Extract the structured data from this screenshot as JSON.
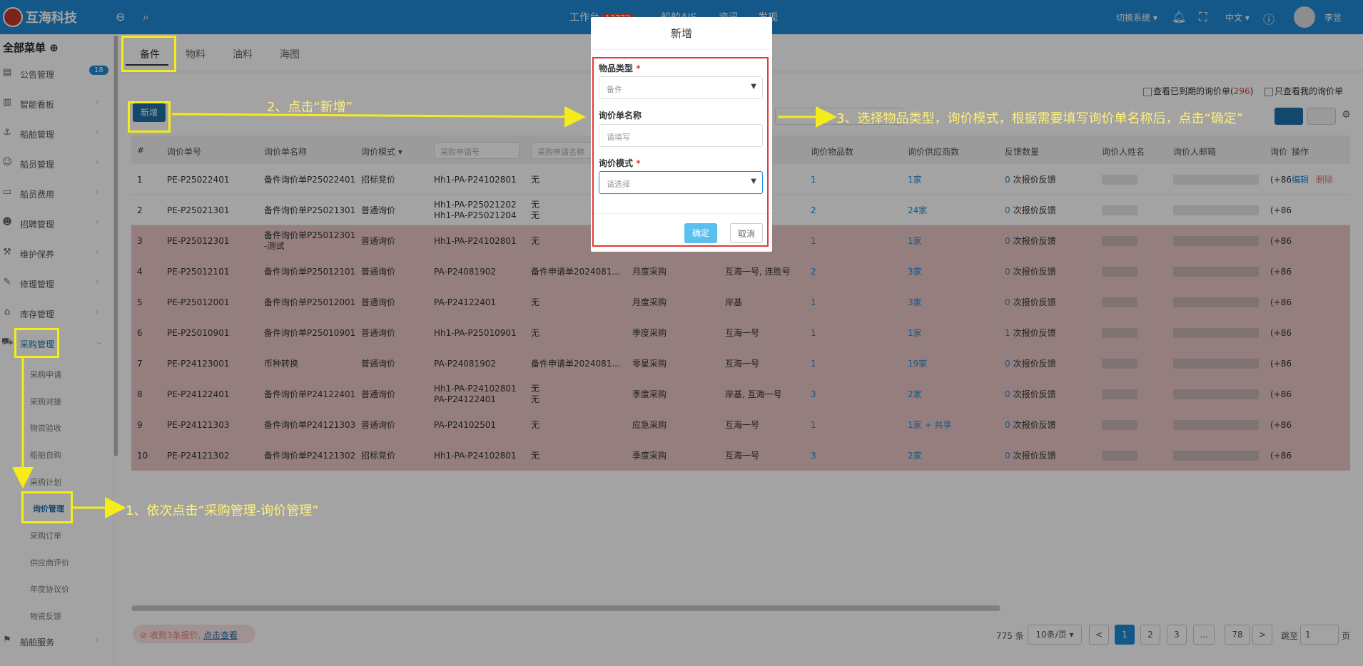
{
  "header": {
    "app_name": "互海科技",
    "nav_workbench": "工作台",
    "nav_badge": "13772",
    "nav_ais": "船舶AIS",
    "nav_3": "资讯",
    "nav_4": "发现",
    "switch_system": "切换系统",
    "language": "中文",
    "user_name": "李昱"
  },
  "sidebar": {
    "title": "全部菜单",
    "items": [
      {
        "label": "公告管理",
        "icon": "book-icon"
      },
      {
        "label": "智能看板",
        "icon": "chart-icon"
      },
      {
        "label": "船舶管理",
        "icon": "anchor-icon"
      },
      {
        "label": "船员管理",
        "icon": "user-icon"
      },
      {
        "label": "船员费用",
        "icon": "wallet-icon"
      },
      {
        "label": "招聘管理",
        "icon": "user-plus-icon"
      },
      {
        "label": "维护保养",
        "icon": "wrench-icon"
      },
      {
        "label": "修理管理",
        "icon": "tool-icon"
      },
      {
        "label": "库存管理",
        "icon": "warehouse-icon"
      },
      {
        "label": "采购管理",
        "icon": "cart-icon"
      },
      {
        "label": "船舶服务",
        "icon": "hammer-icon"
      }
    ],
    "announcement_count": "18",
    "sub_items": [
      "采购申请",
      "采购对接",
      "物资验收",
      "船舶自购",
      "采购计划",
      "询价管理",
      "采购订单",
      "供应商评价",
      "年度协议价",
      "物资反馈"
    ]
  },
  "tabs": [
    "备件",
    "物料",
    "油料",
    "海图"
  ],
  "toolbar": {
    "add_label": "新增",
    "expired_label": "查看已到期的询价单(",
    "expired_count": "296",
    "expired_close": ")",
    "mine_label": "只查看我的询价单"
  },
  "table": {
    "headers": [
      "#",
      "询价单号",
      "询价单名称",
      "询价模式",
      "采购申请号",
      "采购申请名称",
      "询价物品数",
      "询价供应商数",
      "反馈数量",
      "询价人姓名",
      "询价人邮箱",
      "询价",
      "操作"
    ],
    "filter_placeholder_1": "采购申请号",
    "filter_placeholder_2": "采购申请名称",
    "rows": [
      {
        "n": "1",
        "no": "PE-P25022401",
        "name": "备件询价单P25022401",
        "mode": "招标竞价",
        "req": "Hh1-PA-P24102801",
        "req_name": "无",
        "type": "",
        "ship": "",
        "items": "1",
        "suppliers": "1家",
        "fb_n": "0",
        "fb_t": "次报价反馈",
        "tail": "(+86",
        "edit": "编辑",
        "del": "删除"
      },
      {
        "n": "2",
        "no": "PE-P25021301",
        "name": "备件询价单P25021301",
        "mode": "普通询价",
        "req": "Hh1-PA-P25021202",
        "req2": "Hh1-PA-P25021204",
        "req_name": "无",
        "req_name2": "无",
        "type": "",
        "ship": "",
        "items": "2",
        "suppliers": "24家",
        "fb_n": "0",
        "fb_t": "次报价反馈",
        "tail": "(+86"
      },
      {
        "n": "3",
        "no": "PE-P25012301",
        "name": "备件询价单P25012301",
        "name2": "-测试",
        "mode": "普通询价",
        "req": "Hh1-PA-P24102801",
        "req_name": "无",
        "type": "",
        "ship": "",
        "items": "1",
        "suppliers": "1家",
        "fb_n": "0",
        "fb_t": "次报价反馈",
        "tail": "(+86"
      },
      {
        "n": "4",
        "no": "PE-P25012101",
        "name": "备件询价单P25012101",
        "mode": "普通询价",
        "req": "PA-P24081902",
        "req_name": "备件申请单2024081...",
        "type": "月度采购",
        "ship": "互海一号, 连胜号",
        "items": "2",
        "suppliers": "3家",
        "fb_n": "0",
        "fb_t": "次报价反馈",
        "tail": "(+86"
      },
      {
        "n": "5",
        "no": "PE-P25012001",
        "name": "备件询价单P25012001",
        "mode": "普通询价",
        "req": "PA-P24122401",
        "req_name": "无",
        "type": "月度采购",
        "ship": "岸基",
        "items": "1",
        "suppliers": "3家",
        "fb_n": "0",
        "fb_t": "次报价反馈",
        "tail": "(+86"
      },
      {
        "n": "6",
        "no": "PE-P25010901",
        "name": "备件询价单P25010901",
        "mode": "普通询价",
        "req": "Hh1-PA-P25010901",
        "req_name": "无",
        "type": "季度采购",
        "ship": "互海一号",
        "items": "1",
        "suppliers": "1家",
        "fb_n": "1",
        "fb_t": "次报价反馈",
        "tail": "(+86"
      },
      {
        "n": "7",
        "no": "PE-P24123001",
        "name": "币种转换",
        "mode": "普通询价",
        "req": "PA-P24081902",
        "req_name": "备件申请单2024081...",
        "type": "零星采购",
        "ship": "互海一号",
        "items": "1",
        "suppliers": "19家",
        "fb_n": "0",
        "fb_t": "次报价反馈",
        "tail": "(+86"
      },
      {
        "n": "8",
        "no": "PE-P24122401",
        "name": "备件询价单P24122401",
        "mode": "普通询价",
        "req": "Hh1-PA-P24102801",
        "req2": "PA-P24122401",
        "req_name": "无",
        "req_name2": "无",
        "type": "季度采购",
        "ship": "岸基, 互海一号",
        "items": "3",
        "suppliers": "2家",
        "fb_n": "0",
        "fb_t": "次报价反馈",
        "tail": "(+86"
      },
      {
        "n": "9",
        "no": "PE-P24121303",
        "name": "备件询价单P24121303",
        "mode": "普通询价",
        "req": "PA-P24102501",
        "req_name": "无",
        "type": "应急采购",
        "ship": "互海一号",
        "items": "1",
        "suppliers": "1家 + 共享",
        "fb_n": "0",
        "fb_t": "次报价反馈",
        "tail": "(+86"
      },
      {
        "n": "10",
        "no": "PE-P24121302",
        "name": "备件询价单P24121302",
        "mode": "招标竞价",
        "req": "Hh1-PA-P24102801",
        "req_name": "无",
        "type": "季度采购",
        "ship": "互海一号",
        "items": "3",
        "suppliers": "2家",
        "fb_n": "0",
        "fb_t": "次报价反馈",
        "tail": "(+86"
      }
    ]
  },
  "footer": {
    "alert_text": "收到3条报价,",
    "alert_link": "点击查看",
    "total": "775 条",
    "page_size": "10条/页",
    "pages": [
      "1",
      "2",
      "3",
      "...",
      "78"
    ],
    "prev": "<",
    "next": ">",
    "jump_label": "跳至",
    "jump_value": "1",
    "page_suffix": "页"
  },
  "modal": {
    "title": "新增",
    "item_type_label": "物品类型",
    "item_type_value": "备件",
    "name_label": "询价单名称",
    "name_placeholder": "请填写",
    "mode_label": "询价模式",
    "mode_placeholder": "请选择",
    "confirm": "确定",
    "cancel": "取消",
    "required_mark": "*"
  },
  "annotations": {
    "step1": "1、依次点击“采购管理-询价管理”",
    "step2": "2、点击“新增”",
    "step3": "3、选择物品类型，询价模式，根据需要填写询价单名称后，点击“确定”"
  },
  "colors": {
    "primary": "#1e8ad6",
    "annotation": "#f5ec1a",
    "modal_border": "#e53935",
    "row_pink": "#e8c6c6"
  }
}
